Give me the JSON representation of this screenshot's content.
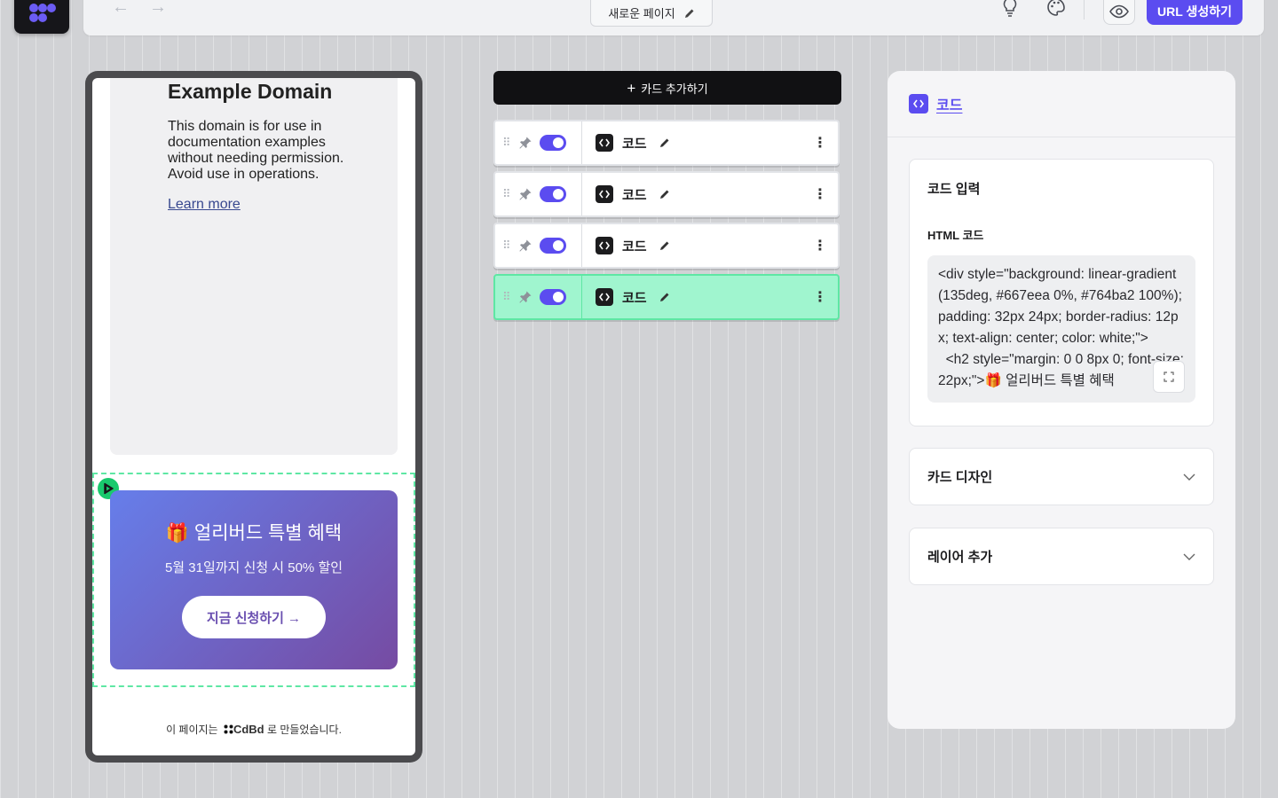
{
  "toolbar": {
    "page_name": "새로운 페이지",
    "url_button": "URL 생성하기"
  },
  "preview": {
    "example_title": "Example Domain",
    "example_body": "This domain is for use in documentation examples without needing permission. Avoid use in operations.",
    "example_link": "Learn more",
    "promo_title": "🎁 얼리버드 특별 혜택",
    "promo_subtitle": "5월 31일까지 신청 시 50% 할인",
    "promo_button": "지금 신청하기 →",
    "footer_prefix": "이 페이지는",
    "footer_brand": "CdBd",
    "footer_suffix": "로 만들었습니다."
  },
  "cards": {
    "add_label": "카드 추가하기",
    "items": [
      {
        "label": "코드",
        "enabled": true,
        "active": false
      },
      {
        "label": "코드",
        "enabled": true,
        "active": false
      },
      {
        "label": "코드",
        "enabled": true,
        "active": false
      },
      {
        "label": "코드",
        "enabled": true,
        "active": true
      }
    ]
  },
  "panel": {
    "title": "코드",
    "code_section_title": "코드 입력",
    "html_label": "HTML 코드",
    "html_code": "<div style=\"background: linear-gradient(135deg, #667eea 0%, #764ba2 100%); padding: 32px 24px; border-radius: 12px; text-align: center; color: white;\">\n  <h2 style=\"margin: 0 0 8px 0; font-size: 22px;\">🎁 얼리버드 특별 혜택",
    "card_design_title": "카드 디자인",
    "layer_title": "레이어 추가"
  },
  "colors": {
    "accent": "#5b4cf0",
    "active_row": "#a0f5cf",
    "selection": "#5ee7a4",
    "promo_start": "#667eea",
    "promo_end": "#764ba2"
  }
}
